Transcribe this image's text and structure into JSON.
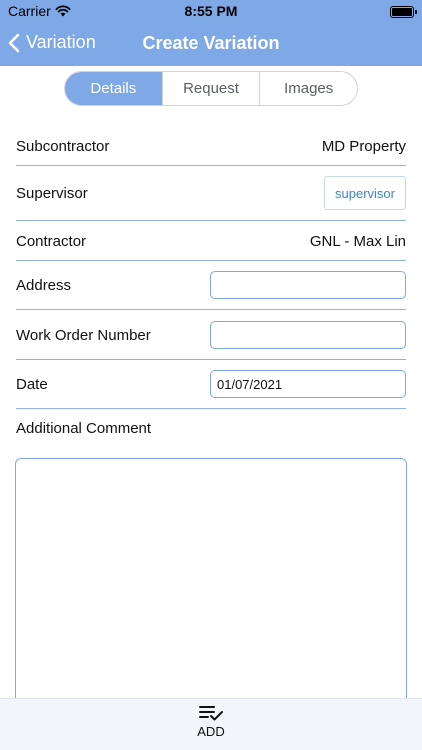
{
  "status_bar": {
    "carrier": "Carrier",
    "time": "8:55 PM"
  },
  "nav": {
    "back_label": "Variation",
    "title": "Create Variation"
  },
  "tabs": [
    {
      "label": "Details",
      "active": true
    },
    {
      "label": "Request",
      "active": false
    },
    {
      "label": "Images",
      "active": false
    }
  ],
  "form": {
    "subcontractor": {
      "label": "Subcontractor",
      "value": "MD Property"
    },
    "supervisor": {
      "label": "Supervisor",
      "button_label": "supervisor"
    },
    "contractor": {
      "label": "Contractor",
      "value": "GNL - Max Lin"
    },
    "address": {
      "label": "Address",
      "value": ""
    },
    "work_order": {
      "label": "Work Order Number",
      "value": ""
    },
    "date": {
      "label": "Date",
      "value": "01/07/2021"
    },
    "comment": {
      "label": "Additional Comment",
      "value": ""
    }
  },
  "bottom": {
    "add_label": "ADD"
  },
  "colors": {
    "accent": "#7ea8e6",
    "divider": "#8fb3e4",
    "link": "#3a84c8"
  }
}
